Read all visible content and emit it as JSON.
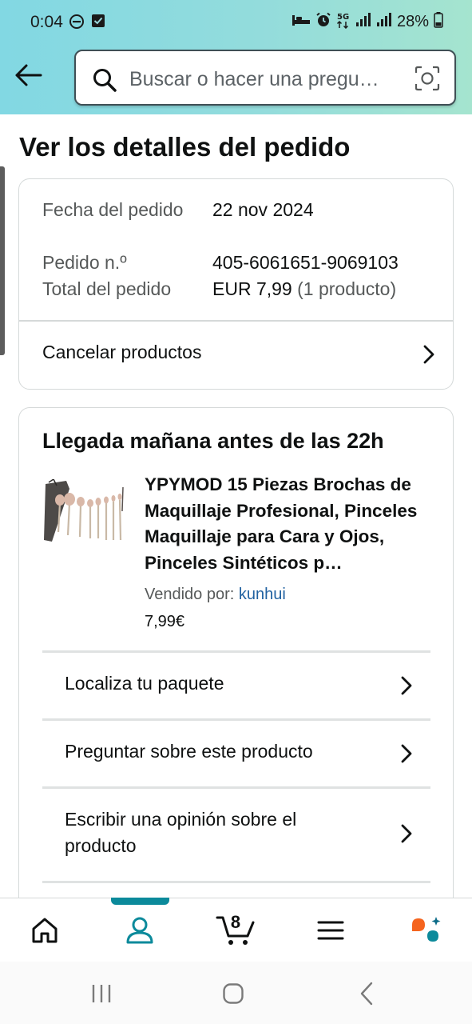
{
  "status_bar": {
    "time": "0:04",
    "battery": "28%",
    "icons": [
      "do-not-disturb-icon",
      "check-notification-icon",
      "sleep-icon",
      "alarm-icon",
      "5g-icon",
      "signal-icon",
      "signal-icon",
      "battery-icon"
    ]
  },
  "header": {
    "back_icon": "arrow-left-icon",
    "search_placeholder": "Buscar o hacer una pregu…",
    "camera_icon": "camera-scan-icon"
  },
  "page": {
    "title": "Ver los detalles del pedido"
  },
  "order_summary": {
    "rows": [
      {
        "label": "Fecha del pedido",
        "value": "22 nov 2024"
      },
      {
        "label": "Pedido n.º",
        "value": "405-6061651-9069103"
      },
      {
        "label": "Total del pedido",
        "value": "EUR 7,99",
        "value_note": "(1 producto)"
      }
    ],
    "cancel_label": "Cancelar productos"
  },
  "delivery": {
    "title": "Llegada mañana antes de las 22h",
    "product": {
      "title": "YPYMOD 15 Piezas Brochas de Maquillaje Profesional, Pinceles Maquillaje para Cara y Ojos, Pinceles Sintéticos p…",
      "seller_prefix": "Vendido por:",
      "seller_name": "kunhui",
      "price": "7,99€"
    },
    "actions": [
      {
        "label": "Localiza tu paquete"
      },
      {
        "label": "Preguntar sobre este producto"
      },
      {
        "label": "Escribir una opinión sobre el producto"
      }
    ]
  },
  "bottom_nav": {
    "active": "profile",
    "cart_count": "8",
    "items": [
      "home-icon",
      "profile-icon",
      "cart-icon",
      "menu-icon",
      "rufus-ai-icon"
    ]
  },
  "colors": {
    "header_gradient_start": "#82d8e3",
    "header_gradient_end": "#a5e4cf",
    "accent_teal": "#0c8a9b",
    "link_blue": "#2162a1",
    "rufus_orange": "#f5641e"
  }
}
